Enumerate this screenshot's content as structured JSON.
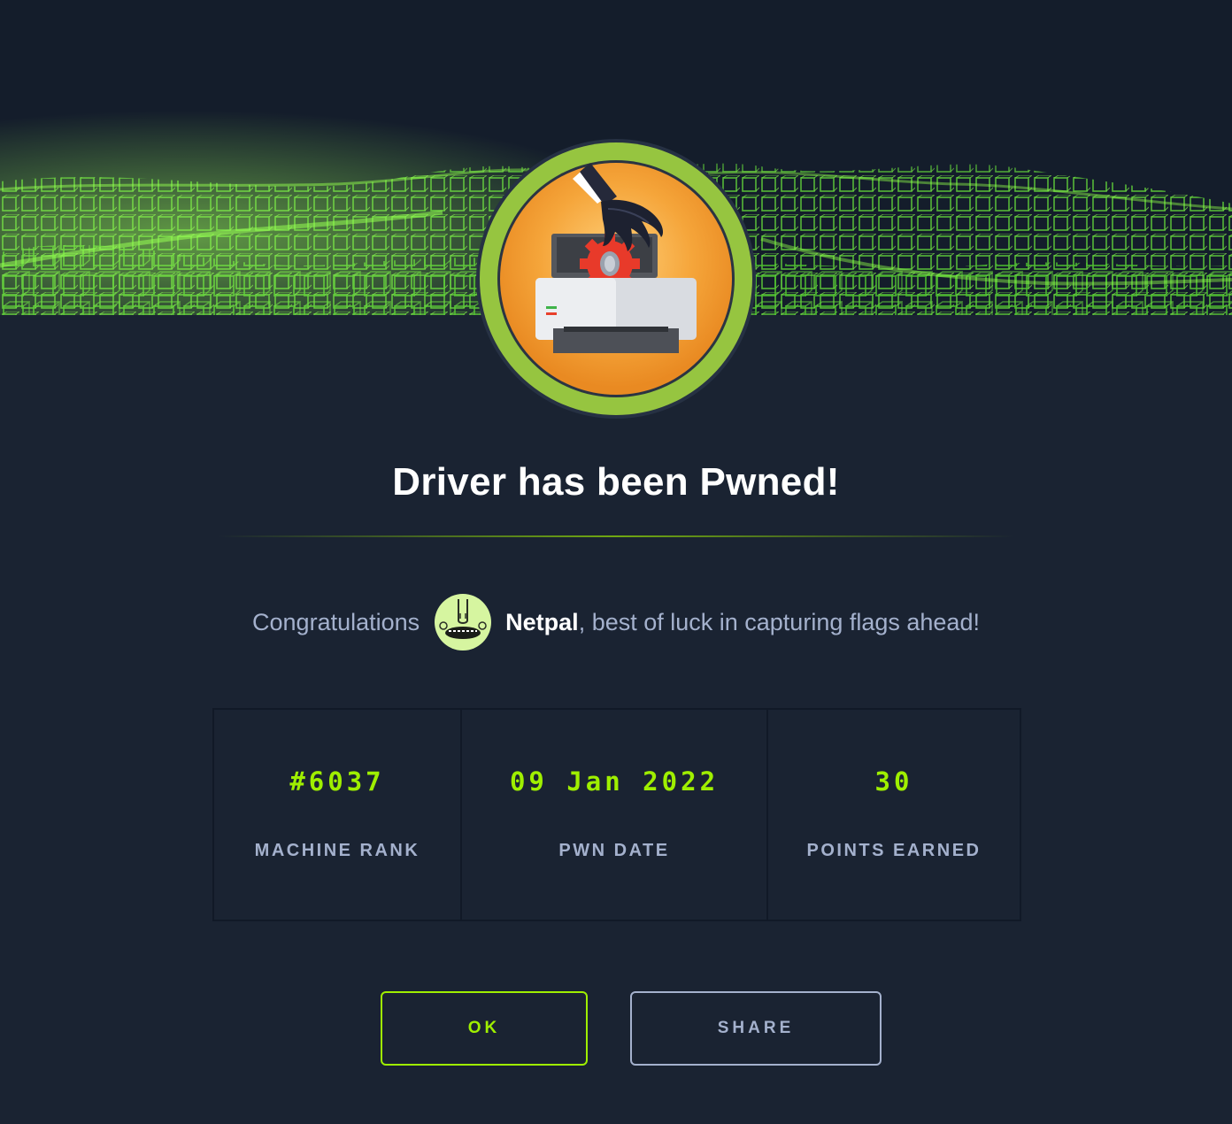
{
  "machine": {
    "name": "Driver",
    "title": "Driver has been Pwned!"
  },
  "congrats": {
    "prefix": "Congratulations",
    "username": "Netpal",
    "suffix": ", best of luck in capturing flags ahead!"
  },
  "stats": [
    {
      "value": "#6037",
      "label": "MACHINE RANK"
    },
    {
      "value": "09 Jan 2022",
      "label": "PWN DATE"
    },
    {
      "value": "30",
      "label": "POINTS EARNED"
    }
  ],
  "buttons": {
    "ok_label": "OK",
    "share_label": "SHARE"
  },
  "icons": {
    "machine_badge": "printer-hacked-icon",
    "user_avatar": "user-avatar-icon"
  },
  "colors": {
    "background": "#1a2332",
    "accent": "#9fef00",
    "muted_text": "#a4b1cd",
    "title_text": "#ffffff"
  }
}
